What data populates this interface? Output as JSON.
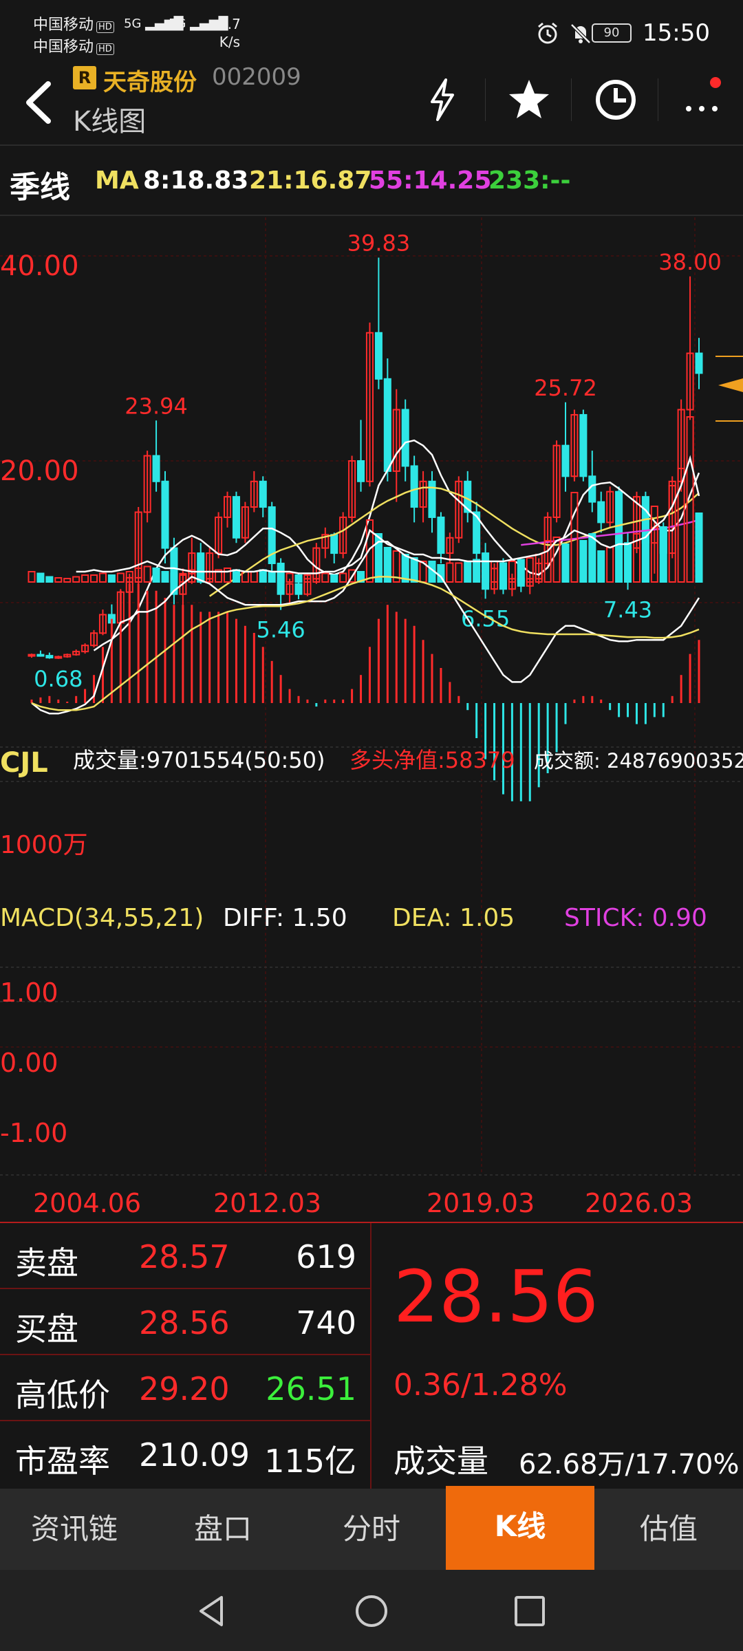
{
  "status_bar": {
    "carrier1": "中国移动",
    "carrier2": "中国移动",
    "hd": "HD",
    "net1": "5G",
    "net2": "5G",
    "speed_value": "6.7",
    "speed_unit": "K/s",
    "battery": "90",
    "time": "15:50",
    "icons": [
      "alarm-icon",
      "mute-icon"
    ]
  },
  "header": {
    "badge": "R",
    "stock_name": "天奇股份",
    "stock_code": "002009",
    "page_subtitle": "K线图",
    "icons": [
      "back-icon",
      "lightning-icon",
      "star-icon",
      "history-clock-icon",
      "more-icon"
    ]
  },
  "ma_row": {
    "period": "季线",
    "ma_label": "MA",
    "ma8": "8:18.83",
    "ma21": "21:16.87",
    "ma55": "55:14.25",
    "ma233": "233:--"
  },
  "chart_data": [
    {
      "type": "candlestick",
      "title": "",
      "ylim": [
        0,
        42
      ],
      "y_ticks": [
        "40.00",
        "20.00"
      ],
      "annotations": [
        "39.83",
        "23.94",
        "38.00",
        "25.72",
        "5.46",
        "6.55",
        "7.43",
        "0.68"
      ],
      "x_ticks": [
        "2004.06",
        "2012.03",
        "2019.03",
        "2026.03"
      ],
      "colors": {
        "up": "#ff2b2b",
        "down": "#2ee6e6",
        "ma8": "#ffffff",
        "ma21": "#f0e060",
        "ma55": "#e040e0"
      },
      "candles": [
        [
          1.0,
          1.2,
          0.8,
          1.1
        ],
        [
          1.1,
          1.5,
          0.9,
          1.0
        ],
        [
          1.0,
          1.3,
          0.7,
          0.8
        ],
        [
          0.8,
          1.0,
          0.68,
          0.9
        ],
        [
          0.9,
          1.2,
          0.8,
          1.1
        ],
        [
          1.1,
          1.6,
          1.0,
          1.4
        ],
        [
          1.4,
          2.2,
          1.2,
          2.0
        ],
        [
          2.0,
          3.5,
          1.8,
          3.2
        ],
        [
          3.2,
          5.5,
          3.0,
          5.0
        ],
        [
          5.0,
          6.0,
          3.8,
          4.2
        ],
        [
          4.2,
          7.5,
          4.0,
          7.2
        ],
        [
          7.2,
          9.0,
          6.0,
          8.6
        ],
        [
          8.6,
          15.5,
          8.0,
          15.0
        ],
        [
          15.0,
          21.0,
          14.0,
          20.5
        ],
        [
          20.5,
          23.94,
          17.0,
          18.0
        ],
        [
          18.0,
          19.0,
          10.0,
          11.5
        ],
        [
          11.5,
          12.5,
          6.0,
          7.0
        ],
        [
          7.0,
          9.5,
          5.0,
          9.0
        ],
        [
          9.0,
          12.5,
          8.0,
          11.0
        ],
        [
          11.0,
          12.0,
          8.0,
          8.5
        ],
        [
          8.5,
          11.5,
          8.0,
          11.0
        ],
        [
          11.0,
          15.0,
          10.5,
          14.5
        ],
        [
          14.5,
          17.0,
          13.5,
          16.5
        ],
        [
          16.5,
          17.0,
          12.0,
          12.5
        ],
        [
          12.5,
          16.0,
          12.0,
          15.5
        ],
        [
          15.5,
          19.0,
          15.0,
          18.0
        ],
        [
          18.0,
          18.5,
          14.5,
          15.5
        ],
        [
          15.5,
          16.0,
          9.0,
          10.0
        ],
        [
          10.0,
          10.5,
          5.46,
          7.0
        ],
        [
          7.0,
          8.5,
          6.0,
          8.0
        ],
        [
          8.0,
          9.0,
          6.5,
          7.0
        ],
        [
          7.0,
          9.0,
          6.8,
          8.5
        ],
        [
          8.5,
          12.0,
          8.0,
          11.5
        ],
        [
          11.5,
          13.5,
          10.5,
          12.8
        ],
        [
          12.8,
          13.0,
          10.0,
          11.0
        ],
        [
          11.0,
          15.0,
          10.5,
          14.5
        ],
        [
          14.5,
          20.5,
          14.0,
          20.0
        ],
        [
          20.0,
          24.0,
          17.0,
          18.0
        ],
        [
          18.0,
          33.5,
          17.5,
          32.5
        ],
        [
          32.5,
          39.83,
          27.0,
          28.0
        ],
        [
          28.0,
          30.0,
          18.0,
          19.0
        ],
        [
          19.0,
          27.0,
          16.0,
          25.0
        ],
        [
          25.0,
          26.0,
          18.0,
          19.5
        ],
        [
          19.5,
          20.5,
          14.0,
          15.5
        ],
        [
          15.5,
          19.0,
          14.0,
          18.0
        ],
        [
          18.0,
          19.0,
          13.0,
          14.5
        ],
        [
          14.5,
          15.0,
          10.0,
          11.0
        ],
        [
          11.0,
          13.0,
          10.0,
          12.5
        ],
        [
          12.5,
          18.5,
          12.0,
          18.0
        ],
        [
          18.0,
          19.0,
          14.0,
          15.0
        ],
        [
          15.0,
          16.0,
          10.0,
          11.0
        ],
        [
          11.0,
          12.0,
          6.55,
          7.5
        ],
        [
          7.5,
          10.0,
          7.0,
          9.5
        ],
        [
          9.5,
          10.5,
          7.0,
          7.5
        ],
        [
          7.5,
          9.0,
          6.8,
          8.5
        ],
        [
          8.5,
          9.5,
          7.2,
          7.8
        ],
        [
          7.8,
          9.0,
          7.0,
          8.5
        ],
        [
          8.5,
          10.5,
          8.0,
          10.0
        ],
        [
          10.0,
          15.0,
          9.5,
          14.5
        ],
        [
          14.5,
          22.0,
          14.0,
          21.5
        ],
        [
          21.5,
          25.72,
          17.0,
          18.5
        ],
        [
          18.5,
          25.0,
          18.0,
          24.5
        ],
        [
          24.5,
          25.0,
          18.0,
          18.5
        ],
        [
          18.5,
          21.0,
          15.0,
          16.0
        ],
        [
          16.0,
          17.0,
          13.0,
          14.0
        ],
        [
          14.0,
          17.5,
          13.5,
          17.0
        ],
        [
          17.0,
          17.5,
          11.0,
          12.0
        ],
        [
          12.0,
          13.0,
          7.43,
          11.5
        ],
        [
          11.5,
          17.0,
          11.0,
          16.5
        ],
        [
          16.5,
          17.0,
          11.0,
          12.0
        ],
        [
          12.0,
          14.0,
          9.0,
          13.5
        ],
        [
          13.5,
          14.0,
          10.0,
          11.0
        ],
        [
          11.0,
          18.5,
          10.5,
          18.0
        ],
        [
          18.0,
          26.0,
          17.0,
          25.0
        ],
        [
          25.0,
          38.0,
          24.0,
          30.5
        ],
        [
          30.5,
          32.0,
          27.0,
          28.56
        ]
      ],
      "ma8": [
        null,
        null,
        null,
        null,
        null,
        null,
        null,
        1.5,
        2.1,
        2.6,
        3.3,
        4.2,
        5.6,
        7.5,
        9.5,
        10.8,
        11.6,
        12.3,
        12.7,
        12.3,
        11.6,
        10.9,
        10.8,
        11.1,
        11.8,
        12.6,
        13.4,
        13.4,
        13.0,
        12.5,
        11.6,
        10.4,
        9.6,
        9.1,
        8.9,
        9.2,
        10.4,
        12.0,
        14.6,
        17.6,
        19.1,
        20.7,
        21.8,
        22.0,
        21.5,
        20.6,
        18.6,
        16.9,
        16.1,
        15.3,
        14.6,
        13.4,
        12.3,
        11.3,
        10.4,
        9.8,
        9.1,
        8.9,
        9.6,
        11.1,
        12.9,
        14.9,
        16.7,
        17.6,
        17.8,
        17.9,
        17.3,
        16.6,
        15.9,
        15.2,
        14.1,
        13.2,
        13.2,
        14.4,
        16.7,
        18.83
      ],
      "ma21": [
        null,
        null,
        null,
        null,
        null,
        null,
        null,
        null,
        null,
        null,
        null,
        null,
        null,
        null,
        null,
        null,
        null,
        null,
        null,
        null,
        6.8,
        7.4,
        8.0,
        8.6,
        9.2,
        9.8,
        10.4,
        10.9,
        11.3,
        11.6,
        11.9,
        12.2,
        12.4,
        12.6,
        12.8,
        13.2,
        13.8,
        14.4,
        15.0,
        15.6,
        16.1,
        16.5,
        16.9,
        17.2,
        17.4,
        17.4,
        17.3,
        17.0,
        16.7,
        16.3,
        15.8,
        15.2,
        14.6,
        14.0,
        13.4,
        12.9,
        12.4,
        12.0,
        11.8,
        11.8,
        12.0,
        12.3,
        12.6,
        12.9,
        13.2,
        13.5,
        13.7,
        13.9,
        14.1,
        14.3,
        14.4,
        14.6,
        14.9,
        15.4,
        16.1,
        16.87
      ],
      "ma55": [
        null,
        null,
        null,
        null,
        null,
        null,
        null,
        null,
        null,
        null,
        null,
        null,
        null,
        null,
        null,
        null,
        null,
        null,
        null,
        null,
        null,
        null,
        null,
        null,
        null,
        null,
        null,
        null,
        null,
        null,
        null,
        null,
        null,
        null,
        null,
        null,
        null,
        null,
        null,
        null,
        null,
        null,
        null,
        null,
        null,
        null,
        null,
        null,
        null,
        null,
        null,
        null,
        null,
        null,
        null,
        11.8,
        11.9,
        12.0,
        12.1,
        12.2,
        12.3,
        12.4,
        12.5,
        12.6,
        12.7,
        12.8,
        12.9,
        13.0,
        13.1,
        13.2,
        13.3,
        13.4,
        13.6,
        13.8,
        14.0,
        14.25
      ]
    },
    {
      "type": "bar",
      "title": "CJL",
      "label": "成交量:9701554(50:50)",
      "net_label": "多头净值:58379",
      "amount_label": "成交额: 24876900352",
      "y_tick": "1000万",
      "ylim": [
        0,
        5000
      ],
      "values": [
        300,
        250,
        150,
        120,
        100,
        150,
        200,
        200,
        250,
        200,
        250,
        300,
        400,
        450,
        400,
        300,
        250,
        200,
        350,
        300,
        300,
        350,
        400,
        350,
        300,
        300,
        350,
        300,
        250,
        250,
        200,
        200,
        250,
        250,
        200,
        250,
        350,
        300,
        1800,
        1400,
        1000,
        900,
        800,
        700,
        600,
        600,
        500,
        550,
        550,
        600,
        650,
        600,
        600,
        550,
        600,
        650,
        700,
        800,
        1200,
        1300,
        1100,
        2600,
        1200,
        1400,
        900,
        1000,
        1300,
        1000,
        1400,
        1200,
        2200,
        1600,
        2800,
        3300,
        4800,
        2000
      ],
      "line": [
        null,
        null,
        null,
        null,
        null,
        300,
        300,
        350,
        300,
        300,
        350,
        400,
        500,
        600,
        500,
        400,
        400,
        350,
        300,
        300,
        300,
        300,
        300,
        350,
        300,
        300,
        350,
        300,
        300,
        300,
        250,
        250,
        250,
        300,
        300,
        400,
        500,
        700,
        1500,
        1300,
        1100,
        1000,
        900,
        800,
        800,
        700,
        700,
        650,
        650,
        600,
        600,
        600,
        600,
        600,
        650,
        700,
        750,
        800,
        900,
        1200,
        1300,
        1500,
        1400,
        1300,
        1100,
        1000,
        1100,
        1100,
        1200,
        1300,
        1600,
        1800,
        2200,
        2800,
        3600,
        2500
      ]
    },
    {
      "type": "bar",
      "title": "MACD(34,55,21)",
      "diff_label": "DIFF: 1.50",
      "dea_label": "DEA: 1.05",
      "stick_label": "STICK: 0.90",
      "y_ticks": [
        "1.00",
        "0.00",
        "-1.00"
      ],
      "ylim": [
        -1.5,
        2.4
      ],
      "stick": [
        0.05,
        0.08,
        0.1,
        0.05,
        0.02,
        0.1,
        0.2,
        0.4,
        0.8,
        1.2,
        1.6,
        1.7,
        1.7,
        1.6,
        1.6,
        1.5,
        1.4,
        1.4,
        1.4,
        1.3,
        1.3,
        1.3,
        1.3,
        1.2,
        1.1,
        1.0,
        0.8,
        0.6,
        0.4,
        0.2,
        0.1,
        0.05,
        -0.05,
        0.05,
        0.05,
        0.05,
        0.2,
        0.4,
        0.8,
        1.2,
        1.4,
        1.3,
        1.2,
        1.1,
        0.9,
        0.7,
        0.5,
        0.3,
        0.1,
        -0.1,
        -0.5,
        -0.8,
        -1.1,
        -1.3,
        -1.4,
        -1.4,
        -1.4,
        -1.2,
        -1.0,
        -0.7,
        -0.3,
        0.05,
        0.1,
        0.1,
        0.05,
        -0.1,
        -0.2,
        -0.2,
        -0.3,
        -0.3,
        -0.2,
        -0.2,
        0.1,
        0.4,
        0.7,
        0.9
      ],
      "diff": [
        0,
        -0.1,
        -0.15,
        -0.15,
        -0.12,
        -0.08,
        -0.02,
        0.1,
        0.5,
        0.9,
        1.15,
        1.2,
        1.3,
        1.3,
        1.35,
        1.45,
        1.6,
        1.7,
        1.8,
        1.75,
        1.7,
        1.6,
        1.5,
        1.45,
        1.4,
        1.4,
        1.4,
        1.4,
        1.4,
        1.42,
        1.45,
        1.45,
        1.45,
        1.45,
        1.5,
        1.6,
        1.8,
        2.0,
        2.2,
        2.3,
        2.3,
        2.2,
        2.1,
        2.05,
        2.0,
        1.9,
        1.8,
        1.6,
        1.4,
        1.2,
        1.0,
        0.8,
        0.6,
        0.4,
        0.3,
        0.3,
        0.4,
        0.6,
        0.8,
        1.0,
        1.1,
        1.1,
        1.05,
        1.0,
        0.95,
        0.9,
        0.88,
        0.88,
        0.9,
        0.9,
        0.9,
        0.9,
        1.0,
        1.1,
        1.3,
        1.5
      ],
      "dea": [
        0,
        -0.05,
        -0.08,
        -0.1,
        -0.1,
        -0.1,
        -0.08,
        -0.05,
        0.05,
        0.15,
        0.25,
        0.35,
        0.45,
        0.55,
        0.65,
        0.75,
        0.85,
        0.95,
        1.05,
        1.12,
        1.2,
        1.25,
        1.3,
        1.33,
        1.35,
        1.37,
        1.38,
        1.38,
        1.38,
        1.4,
        1.42,
        1.45,
        1.5,
        1.55,
        1.6,
        1.65,
        1.7,
        1.74,
        1.78,
        1.8,
        1.8,
        1.79,
        1.77,
        1.75,
        1.72,
        1.68,
        1.63,
        1.56,
        1.48,
        1.4,
        1.32,
        1.24,
        1.17,
        1.1,
        1.05,
        1.02,
        1.0,
        0.99,
        0.98,
        0.98,
        0.98,
        0.98,
        0.98,
        0.98,
        0.97,
        0.96,
        0.95,
        0.94,
        0.94,
        0.94,
        0.93,
        0.93,
        0.94,
        0.96,
        1.0,
        1.05
      ]
    }
  ],
  "quote": {
    "sell_label": "卖盘",
    "sell_price": "28.57",
    "sell_qty": "619",
    "buy_label": "买盘",
    "buy_price": "28.56",
    "buy_qty": "740",
    "hl_label": "高低价",
    "high": "29.20",
    "low": "26.51",
    "pe_label": "市盈率",
    "pe": "210.09",
    "mktcap": "115亿",
    "price": "28.56",
    "change": "0.36/1.28%",
    "volume_label": "成交量",
    "volume": "62.68万/17.70%"
  },
  "tabs": [
    "资讯链",
    "盘口",
    "分时",
    "K线",
    "估值"
  ],
  "nav": [
    "back-nav-icon",
    "home-nav-icon",
    "recents-nav-icon"
  ]
}
